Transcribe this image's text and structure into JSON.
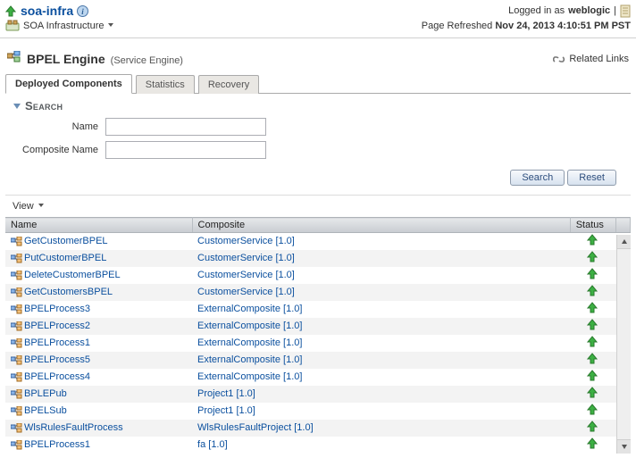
{
  "header": {
    "title": "soa-infra",
    "logged_in_prefix": "Logged in as",
    "logged_in_user": "weblogic",
    "infra_label": "SOA Infrastructure",
    "refreshed_prefix": "Page Refreshed",
    "refreshed_ts": "Nov 24, 2013 4:10:51 PM PST"
  },
  "engine": {
    "title": "BPEL Engine",
    "subtitle": "(Service Engine)",
    "related_links": "Related Links"
  },
  "tabs": {
    "deployed": "Deployed Components",
    "statistics": "Statistics",
    "recovery": "Recovery",
    "active": "deployed"
  },
  "search": {
    "section": "Search",
    "name_label": "Name",
    "composite_label": "Composite Name",
    "name_value": "",
    "composite_value": "",
    "btn_search": "Search",
    "btn_reset": "Reset"
  },
  "toolbar": {
    "view_label": "View"
  },
  "columns": {
    "name": "Name",
    "composite": "Composite",
    "status": "Status"
  },
  "rows": [
    {
      "name": "GetCustomerBPEL",
      "composite": "CustomerService [1.0]",
      "status": "up"
    },
    {
      "name": "PutCustomerBPEL",
      "composite": "CustomerService [1.0]",
      "status": "up"
    },
    {
      "name": "DeleteCustomerBPEL",
      "composite": "CustomerService [1.0]",
      "status": "up"
    },
    {
      "name": "GetCustomersBPEL",
      "composite": "CustomerService [1.0]",
      "status": "up"
    },
    {
      "name": "BPELProcess3",
      "composite": "ExternalComposite [1.0]",
      "status": "up"
    },
    {
      "name": "BPELProcess2",
      "composite": "ExternalComposite [1.0]",
      "status": "up"
    },
    {
      "name": "BPELProcess1",
      "composite": "ExternalComposite [1.0]",
      "status": "up"
    },
    {
      "name": "BPELProcess5",
      "composite": "ExternalComposite [1.0]",
      "status": "up"
    },
    {
      "name": "BPELProcess4",
      "composite": "ExternalComposite [1.0]",
      "status": "up"
    },
    {
      "name": "BPLEPub",
      "composite": "Project1 [1.0]",
      "status": "up"
    },
    {
      "name": "BPELSub",
      "composite": "Project1 [1.0]",
      "status": "up"
    },
    {
      "name": "WlsRulesFaultProcess",
      "composite": "WlsRulesFaultProject [1.0]",
      "status": "up"
    },
    {
      "name": "BPELProcess1",
      "composite": "fa [1.0]",
      "status": "up"
    }
  ]
}
